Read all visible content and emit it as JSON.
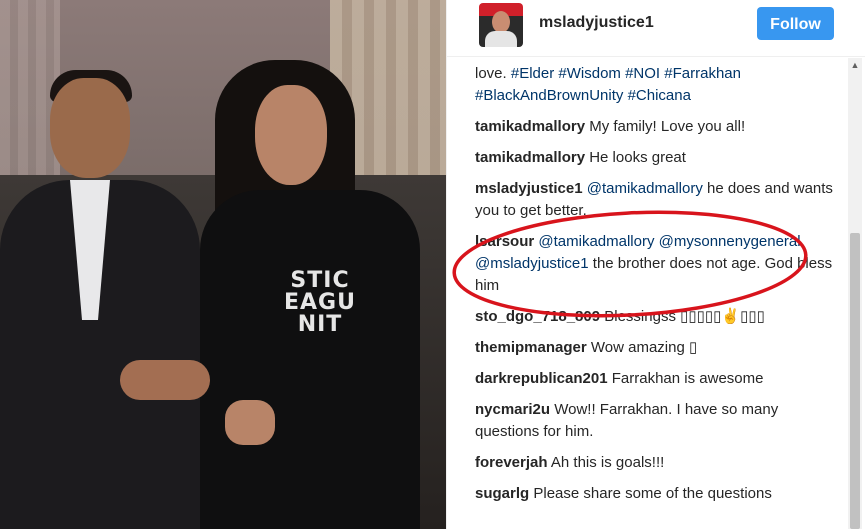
{
  "header": {
    "username": "msladyjustice1",
    "follow_label": "Follow"
  },
  "photo": {
    "shirt_text_line1": "STIC",
    "shirt_text_line2": "EAGU",
    "shirt_text_line3": "NIT"
  },
  "caption": {
    "prefix": "love.",
    "hashtags": [
      "#Elder",
      "#Wisdom",
      "#NOI",
      "#Farrakhan",
      "#BlackAndBrownUnity",
      "#Chicana"
    ]
  },
  "comments": [
    {
      "user": "tamikadmallory",
      "text": "My family! Love you all!"
    },
    {
      "user": "tamikadmallory",
      "text": "He looks great"
    },
    {
      "user": "msladyjustice1",
      "mention": "@tamikadmallory",
      "text": "he does and wants you to get better."
    },
    {
      "user": "lsarsour",
      "mention": "@tamikadmallory @mysonnenygeneral @msladyjustice1",
      "text": "the brother does not age. God bless him"
    },
    {
      "user": "sto_dgo_718_809",
      "text": "Blessingss ▯▯▯▯▯✌▯▯▯"
    },
    {
      "user": "themipmanager",
      "text": "Wow amazing ▯"
    },
    {
      "user": "darkrepublican201",
      "text": "Farrakhan is awesome"
    },
    {
      "user": "nycmari2u",
      "text": "Wow!! Farrakhan. I have so many questions for him."
    },
    {
      "user": "foreverjah",
      "text": "Ah this is goals!!!"
    },
    {
      "user": "sugarlg",
      "text": "Please share some of the questions"
    }
  ],
  "colors": {
    "follow_button": "#3897f0",
    "mention": "#003569",
    "annotation_circle": "#d8141c"
  }
}
